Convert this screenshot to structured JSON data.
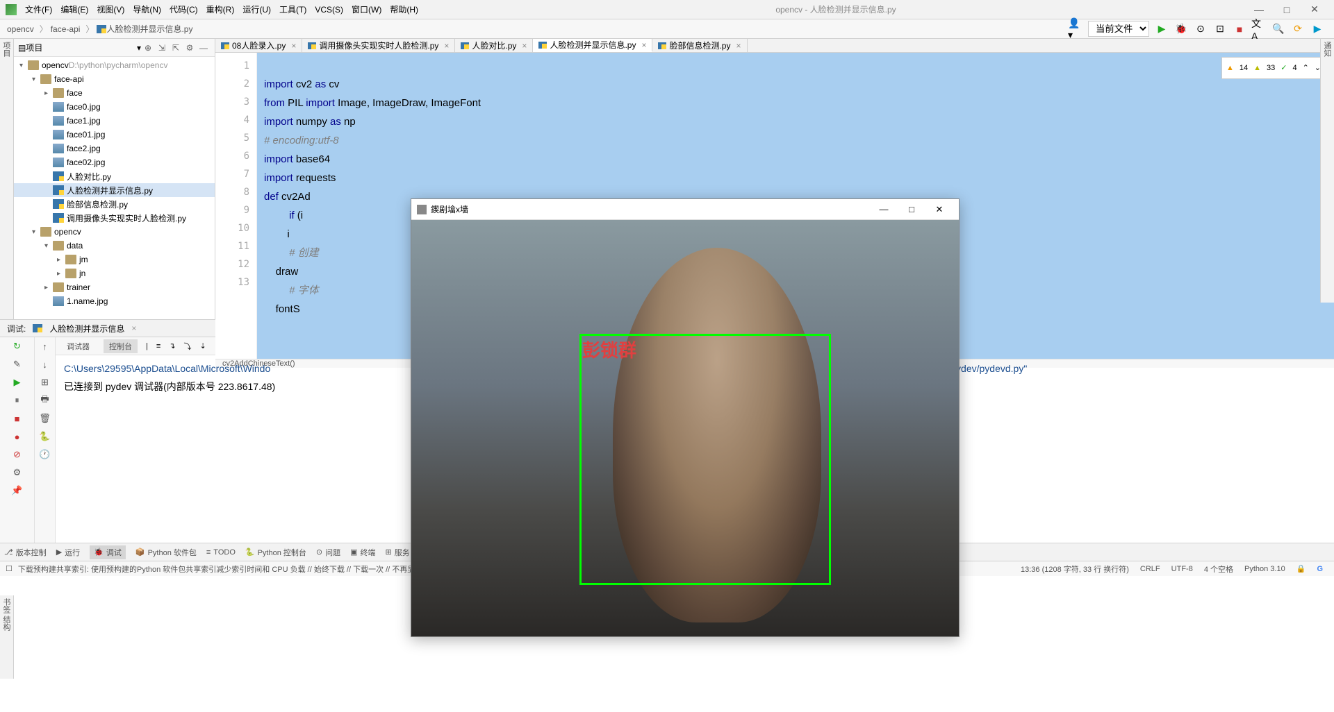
{
  "menu": {
    "file": "文件(F)",
    "edit": "编辑(E)",
    "view": "视图(V)",
    "nav": "导航(N)",
    "code": "代码(C)",
    "refactor": "重构(R)",
    "run": "运行(U)",
    "tools": "工具(T)",
    "vcs": "VCS(S)",
    "window": "窗口(W)",
    "help": "帮助(H)"
  },
  "window_title": "opencv - 人脸检测并显示信息.py",
  "breadcrumb": {
    "p1": "opencv",
    "p2": "face-api",
    "p3": "人脸检测并显示信息.py"
  },
  "run_config": "当前文件",
  "project": {
    "title": "项目",
    "root": {
      "name": "opencv",
      "path": "D:\\python\\pycharm\\opencv"
    },
    "items": [
      {
        "indent": 0,
        "type": "folder",
        "name": "opencv",
        "expand": "open",
        "extra": "  D:\\python\\pycharm\\opencv"
      },
      {
        "indent": 1,
        "type": "folder",
        "name": "face-api",
        "expand": "open"
      },
      {
        "indent": 2,
        "type": "folder",
        "name": "face",
        "expand": "closed"
      },
      {
        "indent": 2,
        "type": "jpg",
        "name": "face0.jpg"
      },
      {
        "indent": 2,
        "type": "jpg",
        "name": "face1.jpg"
      },
      {
        "indent": 2,
        "type": "jpg",
        "name": "face01.jpg"
      },
      {
        "indent": 2,
        "type": "jpg",
        "name": "face2.jpg"
      },
      {
        "indent": 2,
        "type": "jpg",
        "name": "face02.jpg"
      },
      {
        "indent": 2,
        "type": "py",
        "name": "人脸对比.py"
      },
      {
        "indent": 2,
        "type": "py",
        "name": "人脸检测并显示信息.py",
        "sel": true
      },
      {
        "indent": 2,
        "type": "py",
        "name": "脸部信息检测.py"
      },
      {
        "indent": 2,
        "type": "py",
        "name": "调用摄像头实现实时人脸检测.py"
      },
      {
        "indent": 1,
        "type": "folder",
        "name": "opencv",
        "expand": "open"
      },
      {
        "indent": 2,
        "type": "folder",
        "name": "data",
        "expand": "open"
      },
      {
        "indent": 3,
        "type": "folder",
        "name": "jm",
        "expand": "closed"
      },
      {
        "indent": 3,
        "type": "folder",
        "name": "jn",
        "expand": "closed"
      },
      {
        "indent": 2,
        "type": "folder",
        "name": "trainer",
        "expand": "closed"
      },
      {
        "indent": 2,
        "type": "jpg",
        "name": "1.name.jpg"
      }
    ]
  },
  "tabs": [
    {
      "name": "08人脸录入.py"
    },
    {
      "name": "调用摄像头实现实时人脸检测.py"
    },
    {
      "name": "人脸对比.py"
    },
    {
      "name": "人脸检测并显示信息.py",
      "active": true
    },
    {
      "name": "脸部信息检测.py"
    }
  ],
  "inspection": {
    "warn1": "14",
    "warn2": "33",
    "check": "4"
  },
  "lines": [
    "1",
    "2",
    "3",
    "4",
    "5",
    "6",
    "7",
    "8",
    "9",
    "10",
    "11",
    "12",
    "13"
  ],
  "code": {
    "l1a": "import",
    "l1b": " cv2 ",
    "l1c": "as",
    "l1d": " cv",
    "l2a": "from",
    "l2b": " PIL ",
    "l2c": "import",
    "l2d": " Image, ImageDraw, ImageFont",
    "l3a": "import",
    "l3b": " numpy ",
    "l3c": "as",
    "l3d": " np",
    "l4": "# encoding:utf-8",
    "l5a": "import",
    "l5b": " base64",
    "l6a": "import",
    "l6b": " requests",
    "l7a": "def",
    "l7b": " cv2Ad",
    "l8a": "if",
    "l8b": " (i",
    "l9": "        i",
    "l10": "# 创建",
    "l11": "    draw ",
    "l12": "# 字体",
    "l13": "    fontS"
  },
  "editor_crumb": "cv2AddChineseText()",
  "debug": {
    "label": "调试:",
    "run_name": "人脸检测并显示信息",
    "tab1": "调试器",
    "tab2": "控制台"
  },
  "console": {
    "cmd": "C:\\Users\\29595\\AppData\\Local\\Microsoft\\Windo",
    "cmd_tail": ".2/plugins/python-ce/helpers/pydev/pydevd.py\"",
    "attached": "已连接到 pydev 调试器(内部版本号 223.8617.48)"
  },
  "toolwin": {
    "vcs": "版本控制",
    "run": "运行",
    "debug": "调试",
    "pkg": "Python 软件包",
    "todo": "TODO",
    "pyconsole": "Python 控制台",
    "problems": "问题",
    "terminal": "终端",
    "services": "服务"
  },
  "status": {
    "msg": "下载预构建共享索引: 使用预构建的Python 软件包共享索引减少索引时间和 CPU 负载 // 始终下载 // 下载一次 // 不再显示 // 配置... (今天 17:59)",
    "pos": "13:36 (1208 字符, 33 行 换行符)",
    "crlf": "CRLF",
    "enc": "UTF-8",
    "indent": "4 个空格",
    "interp": "Python 3.10"
  },
  "cv_window": {
    "title": "鍥剧墖x墙",
    "face_label": "彭锁群"
  },
  "side_left": "项目",
  "side_right": "通知",
  "side_bot": "书签  结构"
}
